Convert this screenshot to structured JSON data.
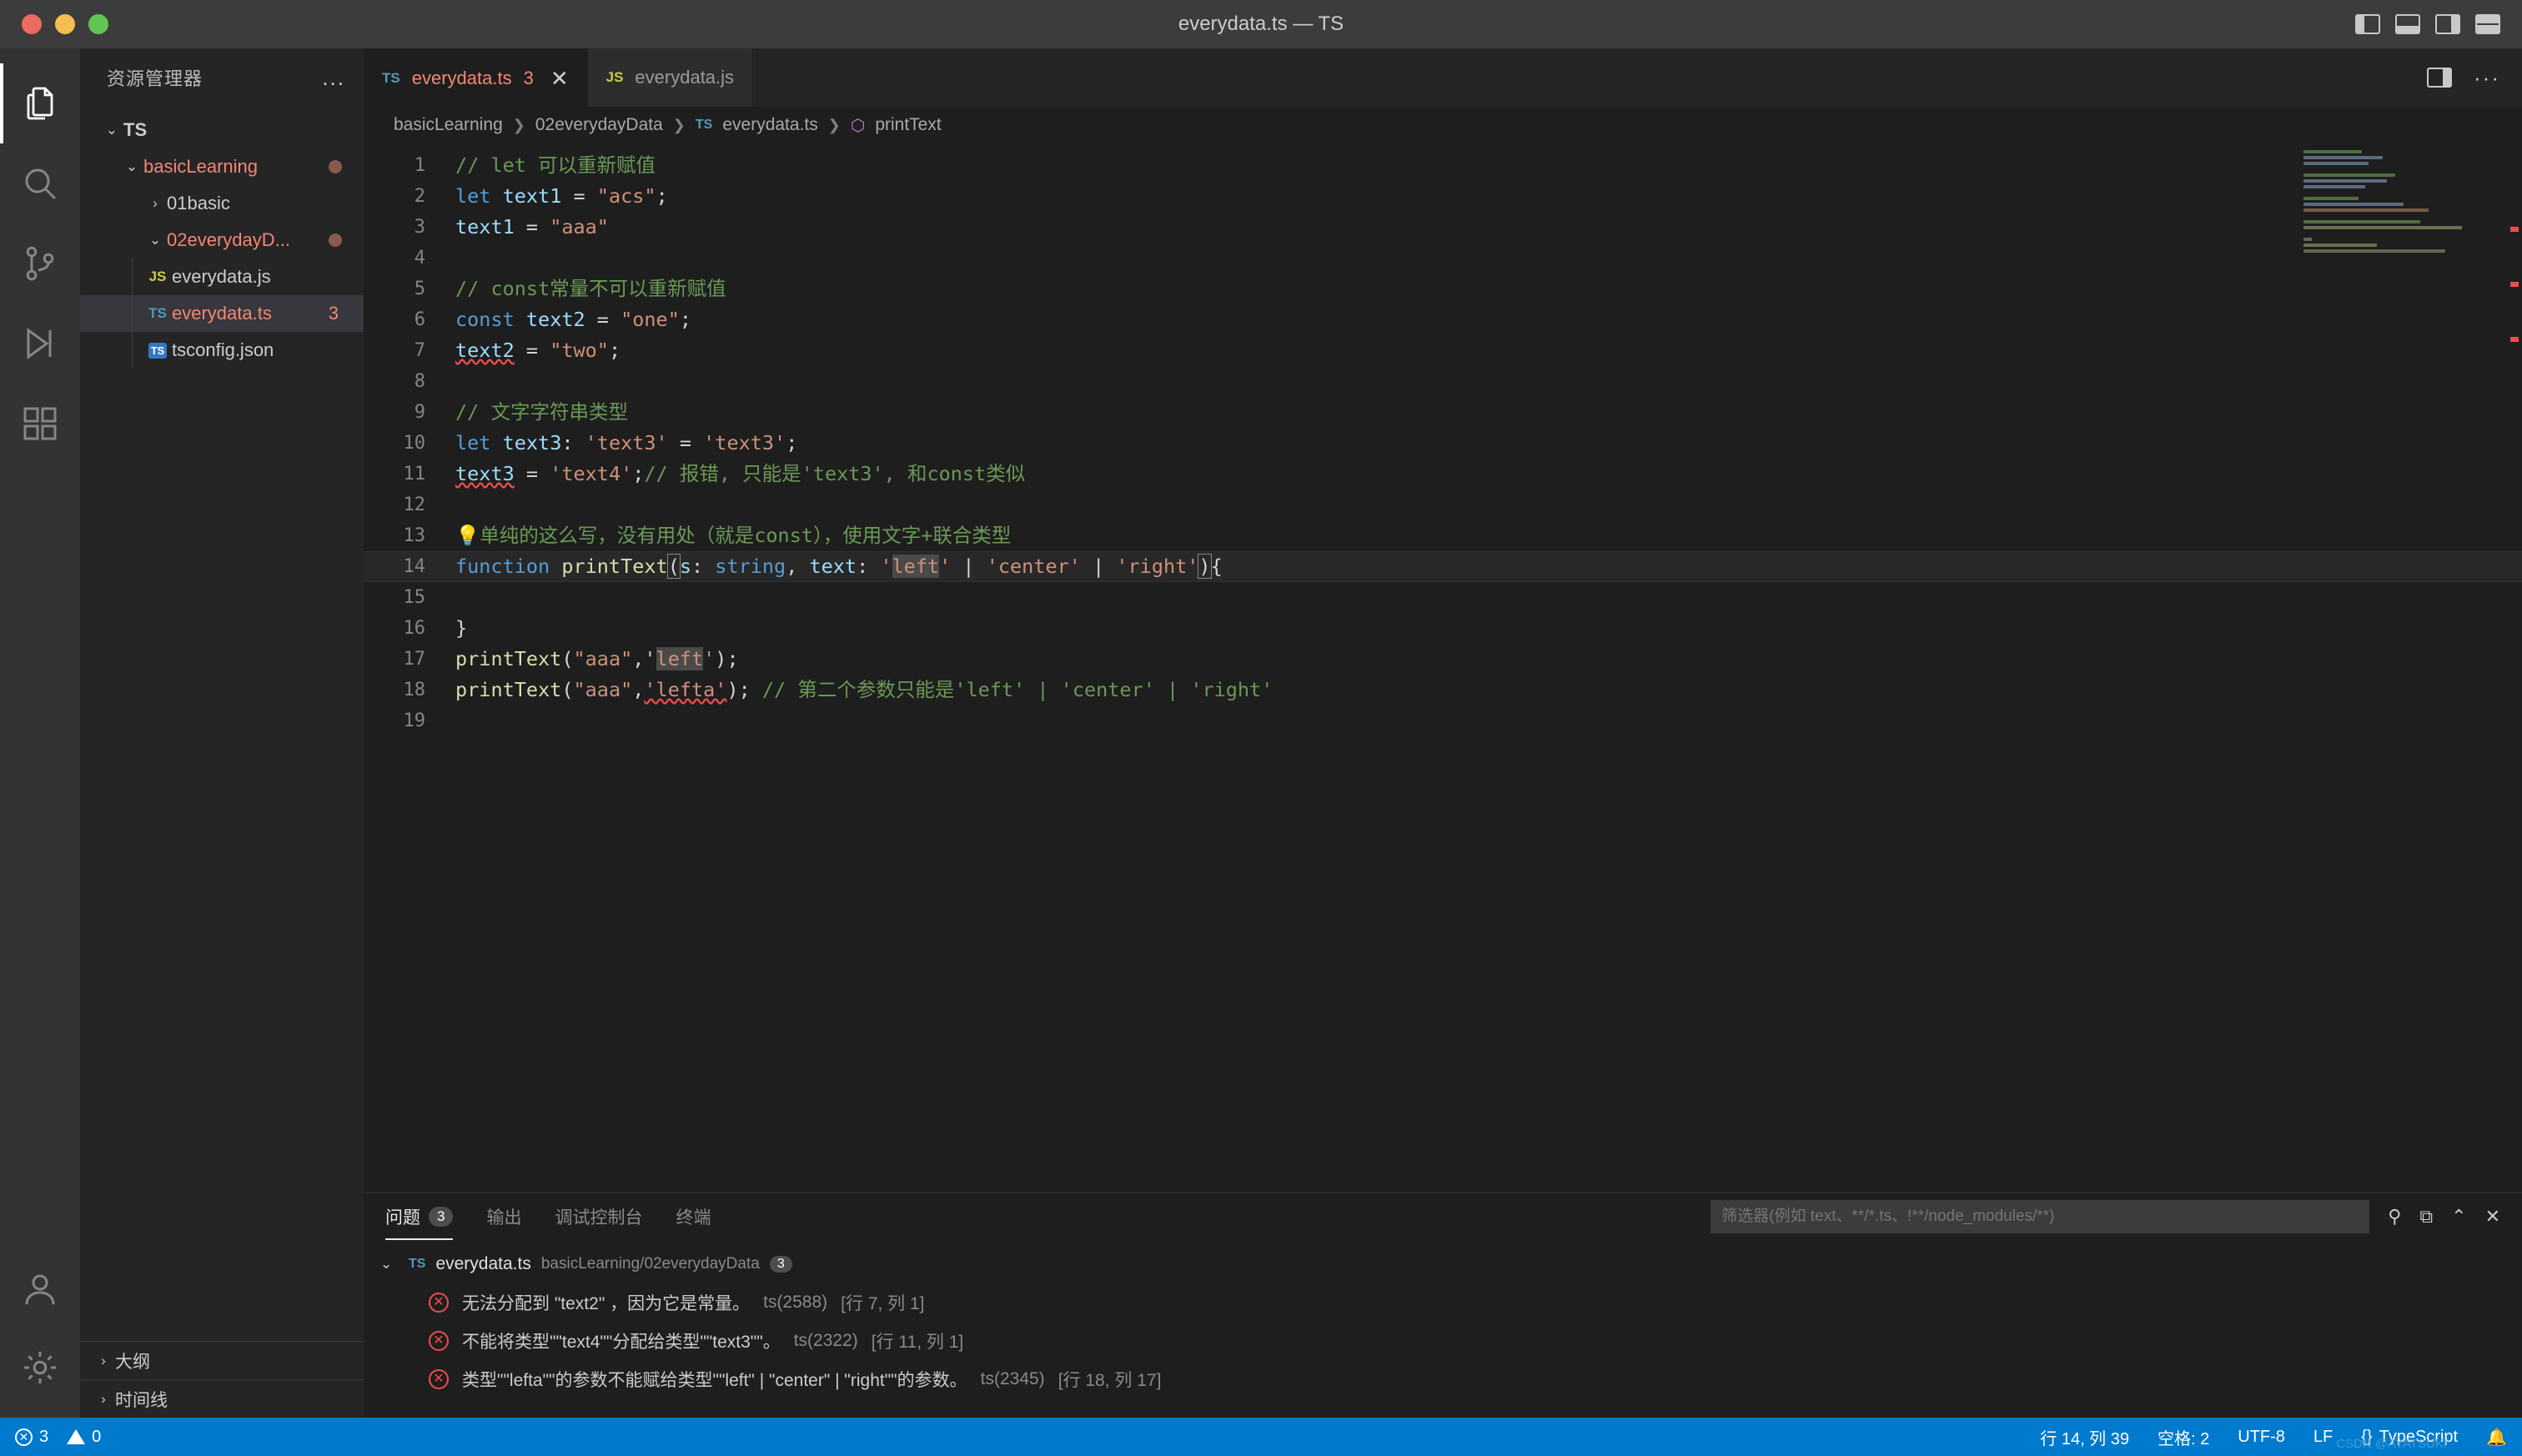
{
  "window": {
    "title": "everydata.ts — TS"
  },
  "titlebar_actions": [
    "panel-left-icon",
    "panel-bottom-icon",
    "panel-right-icon",
    "layout-grid-icon"
  ],
  "activitybar": [
    {
      "name": "explorer",
      "icon": "files-icon",
      "active": true
    },
    {
      "name": "search",
      "icon": "search-icon",
      "active": false
    },
    {
      "name": "source-control",
      "icon": "source-control-icon",
      "active": false
    },
    {
      "name": "run-debug",
      "icon": "run-debug-icon",
      "active": false
    },
    {
      "name": "extensions",
      "icon": "extensions-icon",
      "active": false
    },
    {
      "name": "accounts",
      "icon": "account-icon",
      "active": false
    },
    {
      "name": "settings",
      "icon": "gear-icon",
      "active": false
    }
  ],
  "sidebar": {
    "title": "资源管理器",
    "more_label": "...",
    "tree": [
      {
        "label": "TS",
        "chev": "⌄",
        "depth": 0,
        "kind": "root",
        "selected": false
      },
      {
        "label": "basicLearning",
        "chev": "⌄",
        "depth": 1,
        "kind": "folder",
        "modified": true,
        "selected": false
      },
      {
        "label": "01basic",
        "chev": "›",
        "depth": 2,
        "kind": "folder",
        "selected": false
      },
      {
        "label": "02everydayD...",
        "chev": "⌄",
        "depth": 2,
        "kind": "folder",
        "modified": true,
        "selected": false
      },
      {
        "label": "everydata.js",
        "icon": "JS",
        "depth": 3,
        "kind": "file-js",
        "selected": false
      },
      {
        "label": "everydata.ts",
        "icon": "TS",
        "depth": 3,
        "kind": "file-ts",
        "selected": true,
        "count": "3"
      },
      {
        "label": "tsconfig.json",
        "icon": "TS",
        "depth": 3,
        "kind": "file-tsconfig",
        "selected": false
      }
    ],
    "sections": [
      {
        "label": "大纲",
        "chev": "›"
      },
      {
        "label": "时间线",
        "chev": "›"
      }
    ]
  },
  "tabs": [
    {
      "icon": "TS",
      "label": "everydata.ts",
      "count": "3",
      "close": "✕",
      "active": true
    },
    {
      "icon": "JS",
      "label": "everydata.js",
      "count": "",
      "close": "",
      "active": false
    }
  ],
  "tabbar_actions": [
    "split-editor-icon",
    "more-actions-icon"
  ],
  "breadcrumb": [
    {
      "label": "basicLearning",
      "icon": ""
    },
    {
      "label": "02everydayData",
      "icon": ""
    },
    {
      "label": "everydata.ts",
      "icon": "TS"
    },
    {
      "label": "printText",
      "icon": "method-icon"
    }
  ],
  "code": {
    "lines": [
      {
        "n": "1",
        "current": false,
        "tokens": [
          {
            "t": "// let 可以重新赋值",
            "c": "cmt"
          }
        ]
      },
      {
        "n": "2",
        "current": false,
        "tokens": [
          {
            "t": "let",
            "c": "kw"
          },
          {
            "t": " ",
            "c": "pun"
          },
          {
            "t": "text1",
            "c": "var"
          },
          {
            "t": " = ",
            "c": "pun"
          },
          {
            "t": "\"acs\"",
            "c": "str"
          },
          {
            "t": ";",
            "c": "pun"
          }
        ]
      },
      {
        "n": "3",
        "current": false,
        "tokens": [
          {
            "t": "text1",
            "c": "var"
          },
          {
            "t": " = ",
            "c": "pun"
          },
          {
            "t": "\"aaa\"",
            "c": "str"
          }
        ]
      },
      {
        "n": "4",
        "current": false,
        "tokens": []
      },
      {
        "n": "5",
        "current": false,
        "tokens": [
          {
            "t": "// const常量不可以重新赋值",
            "c": "cmt"
          }
        ]
      },
      {
        "n": "6",
        "current": false,
        "tokens": [
          {
            "t": "const",
            "c": "kw"
          },
          {
            "t": " ",
            "c": "pun"
          },
          {
            "t": "text2",
            "c": "var"
          },
          {
            "t": " = ",
            "c": "pun"
          },
          {
            "t": "\"one\"",
            "c": "str"
          },
          {
            "t": ";",
            "c": "pun"
          }
        ]
      },
      {
        "n": "7",
        "current": false,
        "tokens": [
          {
            "t": "text2",
            "c": "var squiggle"
          },
          {
            "t": " = ",
            "c": "pun"
          },
          {
            "t": "\"two\"",
            "c": "str"
          },
          {
            "t": ";",
            "c": "pun"
          }
        ]
      },
      {
        "n": "8",
        "current": false,
        "tokens": []
      },
      {
        "n": "9",
        "current": false,
        "tokens": [
          {
            "t": "// 文字字符串类型",
            "c": "cmt"
          }
        ]
      },
      {
        "n": "10",
        "current": false,
        "tokens": [
          {
            "t": "let",
            "c": "kw"
          },
          {
            "t": " ",
            "c": "pun"
          },
          {
            "t": "text3",
            "c": "var"
          },
          {
            "t": ": ",
            "c": "pun"
          },
          {
            "t": "'text3'",
            "c": "str"
          },
          {
            "t": " = ",
            "c": "pun"
          },
          {
            "t": "'text3'",
            "c": "str"
          },
          {
            "t": ";",
            "c": "pun"
          }
        ]
      },
      {
        "n": "11",
        "current": false,
        "tokens": [
          {
            "t": "text3",
            "c": "var squiggle"
          },
          {
            "t": " = ",
            "c": "pun"
          },
          {
            "t": "'text4'",
            "c": "str"
          },
          {
            "t": ";",
            "c": "pun"
          },
          {
            "t": "// 报错, 只能是'text3', 和const类似",
            "c": "cmt"
          }
        ]
      },
      {
        "n": "12",
        "current": false,
        "tokens": []
      },
      {
        "n": "13",
        "current": false,
        "tokens": [
          {
            "t": "💡单纯的这么写，没有用处（就是const），使用文字+联合类型",
            "c": "cmt"
          }
        ]
      },
      {
        "n": "14",
        "current": true,
        "tokens": [
          {
            "t": "function",
            "c": "kw"
          },
          {
            "t": " ",
            "c": "pun"
          },
          {
            "t": "printText",
            "c": "fn"
          },
          {
            "t": "(",
            "c": "pun bracket-m"
          },
          {
            "t": "s",
            "c": "var"
          },
          {
            "t": ": ",
            "c": "pun"
          },
          {
            "t": "string",
            "c": "kw"
          },
          {
            "t": ", ",
            "c": "pun"
          },
          {
            "t": "text",
            "c": "var"
          },
          {
            "t": ": ",
            "c": "pun"
          },
          {
            "t": "'",
            "c": "str"
          },
          {
            "t": "left",
            "c": "str sel-hl"
          },
          {
            "t": "'",
            "c": "str"
          },
          {
            "t": " | ",
            "c": "pun"
          },
          {
            "t": "'center'",
            "c": "str"
          },
          {
            "t": " | ",
            "c": "pun"
          },
          {
            "t": "'right'",
            "c": "str"
          },
          {
            "t": ")",
            "c": "pun bracket-m"
          },
          {
            "t": "{",
            "c": "pun"
          }
        ]
      },
      {
        "n": "15",
        "current": false,
        "tokens": []
      },
      {
        "n": "16",
        "current": false,
        "tokens": [
          {
            "t": "}",
            "c": "pun"
          }
        ]
      },
      {
        "n": "17",
        "current": false,
        "tokens": [
          {
            "t": "printText",
            "c": "fn"
          },
          {
            "t": "(",
            "c": "pun"
          },
          {
            "t": "\"aaa\"",
            "c": "str"
          },
          {
            "t": ",'",
            "c": "pun"
          },
          {
            "t": "left",
            "c": "str sel-hl"
          },
          {
            "t": "'",
            "c": "str"
          },
          {
            "t": ");",
            "c": "pun"
          }
        ]
      },
      {
        "n": "18",
        "current": false,
        "tokens": [
          {
            "t": "printText",
            "c": "fn"
          },
          {
            "t": "(",
            "c": "pun"
          },
          {
            "t": "\"aaa\"",
            "c": "str"
          },
          {
            "t": ",",
            "c": "pun"
          },
          {
            "t": "'lefta'",
            "c": "str squiggle"
          },
          {
            "t": "); ",
            "c": "pun"
          },
          {
            "t": "// 第二个参数只能是'left' | 'center' | 'right'",
            "c": "cmt"
          }
        ]
      },
      {
        "n": "19",
        "current": false,
        "tokens": []
      }
    ]
  },
  "panel": {
    "tabs": [
      {
        "label": "问题",
        "badge": "3",
        "active": true
      },
      {
        "label": "输出",
        "badge": "",
        "active": false
      },
      {
        "label": "调试控制台",
        "badge": "",
        "active": false
      },
      {
        "label": "终端",
        "badge": "",
        "active": false
      }
    ],
    "filter_placeholder": "筛选器(例如 text、**/*.ts、!**/node_modules/**)",
    "actions": [
      "filter-icon",
      "copy-icon",
      "chevron-up-icon",
      "close-icon"
    ],
    "file_group": {
      "chev": "⌄",
      "icon": "TS",
      "file": "everydata.ts",
      "path": "basicLearning/02everydayData",
      "count": "3"
    },
    "items": [
      {
        "severity": "error",
        "message": "无法分配到 \"text2\" ，因为它是常量。",
        "code": "ts(2588)",
        "loc": "[行 7, 列 1]"
      },
      {
        "severity": "error",
        "message": "不能将类型\"\"text4\"\"分配给类型\"\"text3\"\"。",
        "code": "ts(2322)",
        "loc": "[行 11, 列 1]"
      },
      {
        "severity": "error",
        "message": "类型\"\"lefta\"\"的参数不能赋给类型\"\"left\" | \"center\" | \"right\"\"的参数。",
        "code": "ts(2345)",
        "loc": "[行 18, 列 17]"
      }
    ]
  },
  "statusbar": {
    "errors": "3",
    "warnings": "0",
    "cursor": "行 14, 列 39",
    "spaces": "空格: 2",
    "encoding": "UTF-8",
    "eol": "LF",
    "language": "TypeScript",
    "bell": "🔔",
    "watermark": "CSDN @AYATSUKI"
  },
  "colors": {
    "accent": "#007acc",
    "error": "#f14c4c",
    "modified": "#e2c08d",
    "ts_blue": "#519aba",
    "js_yellow": "#cbcb41"
  }
}
